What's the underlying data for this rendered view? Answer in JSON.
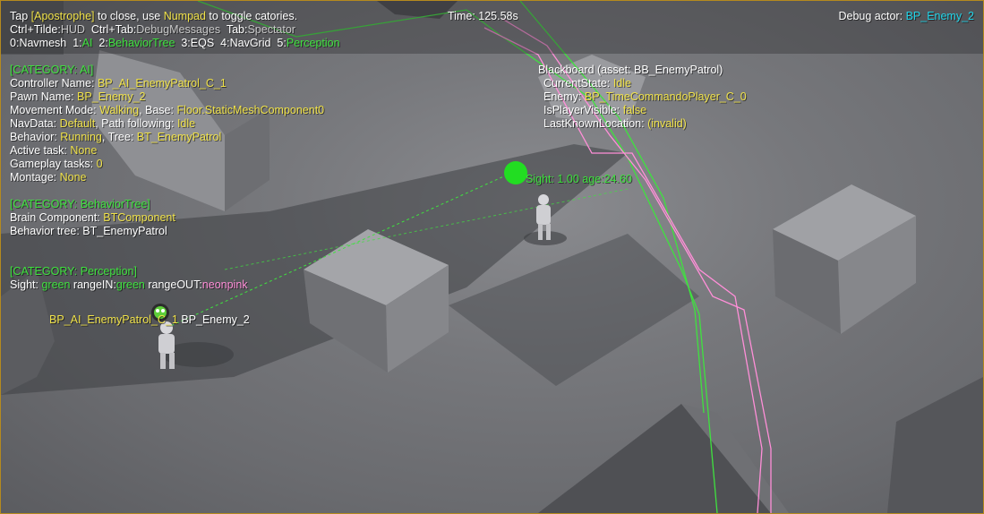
{
  "hud": {
    "tap": "Tap",
    "apostrophe": "[Apostrophe]",
    "to_close_use": "to close, use",
    "numpad": "Numpad",
    "to_toggle": "to toggle catories.",
    "line2_a": "Ctrl+Tilde:",
    "line2_b": "HUD",
    "line2_c": "Ctrl+Tab:",
    "line2_d": "DebugMessages",
    "line2_e": "Tab:",
    "line2_f": "Spectator",
    "categories": [
      {
        "key": "0:",
        "name": "Navmesh",
        "active": false
      },
      {
        "key": "1:",
        "name": "AI",
        "active": true
      },
      {
        "key": "2:",
        "name": "BehaviorTree",
        "active": true
      },
      {
        "key": "3:",
        "name": "EQS",
        "active": false
      },
      {
        "key": "4:",
        "name": "NavGrid",
        "active": false
      },
      {
        "key": "5:",
        "name": "Perception",
        "active": true
      }
    ],
    "time": "Time: 125.58s",
    "debug_actor_label": "Debug actor:",
    "debug_actor_value": "BP_Enemy_2"
  },
  "ai": {
    "header": "[CATEGORY: AI]",
    "controller_label": "Controller Name:",
    "controller_value": "BP_AI_EnemyPatrol_C_1",
    "pawn_label": "Pawn Name:",
    "pawn_value": "BP_Enemy_2",
    "movement_label": "Movement Mode:",
    "movement_value": "Walking",
    "base_label": ", Base:",
    "base_value": "Floor.StaticMeshComponent0",
    "navdata_label": "NavData:",
    "navdata_value": "Default",
    "path_label": ", Path following:",
    "path_value": "Idle",
    "behavior_label": "Behavior:",
    "behavior_value": "Running",
    "tree_label": ", Tree:",
    "tree_value": "BT_EnemyPatrol",
    "active_task_label": "Active task:",
    "active_task_value": "None",
    "gameplay_tasks_label": "Gameplay tasks:",
    "gameplay_tasks_value": "0",
    "montage_label": "Montage:",
    "montage_value": "None"
  },
  "bt": {
    "header": "[CATEGORY: BehaviorTree]",
    "brain_label": "Brain Component:",
    "brain_value": "BTComponent",
    "tree_line": "Behavior tree: BT_EnemyPatrol"
  },
  "perception": {
    "header": "[CATEGORY: Perception]",
    "sight_label": "Sight:",
    "sight_value": "green",
    "range_in_label": "rangeIN:",
    "range_in_value": "green",
    "range_out_label": "rangeOUT:",
    "range_out_value": "neonpink"
  },
  "blackboard": {
    "title": "Blackboard (asset: BB_EnemyPatrol)",
    "current_state_label": "CurrentState:",
    "current_state_value": "Idle",
    "enemy_label": "Enemy:",
    "enemy_value": "BP_TimeCommandoPlayer_C_0",
    "visible_label": "IsPlayerVisible:",
    "visible_value": "false",
    "location_label": "LastKnownLocation:",
    "location_value": "(invalid)"
  },
  "world": {
    "sight_stimulus": "Sight: 1.00 age:24.60",
    "actor_controller": "BP_AI_EnemyPatrol_C_1",
    "actor_pawn": "BP_Enemy_2"
  },
  "colors": {
    "yellow": "#f0e24a",
    "green": "#3fe23f",
    "cyan": "#22d4e8",
    "pink": "#ff8fd8",
    "border": "#b58a1e"
  }
}
